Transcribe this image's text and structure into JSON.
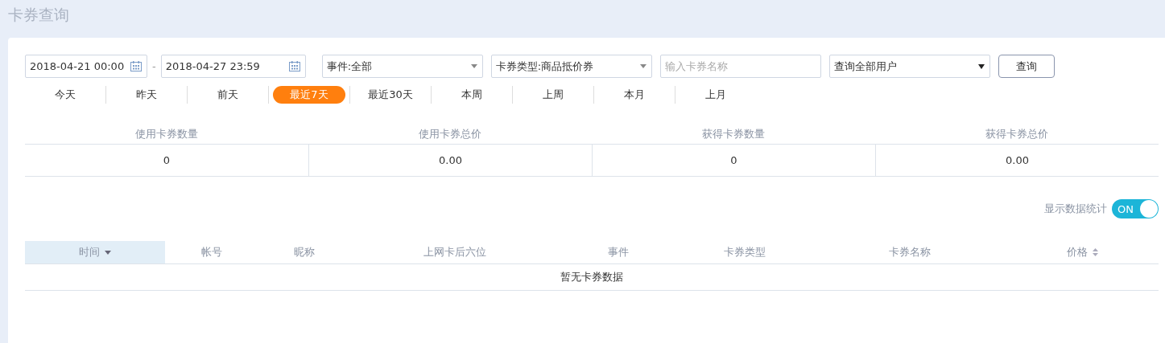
{
  "page_title": "卡券查询",
  "filters": {
    "start_date": "2018-04-21 00:00",
    "separator": "-",
    "end_date": "2018-04-27 23:59",
    "event": "事件:全部",
    "card_type": "卡券类型:商品抵价券",
    "name_field": {
      "placeholder": "输入卡券名称"
    },
    "user_scope": "查询全部用户",
    "query_button": "查询"
  },
  "ranges": [
    {
      "label": "今天",
      "selected": false
    },
    {
      "label": "昨天",
      "selected": false
    },
    {
      "label": "前天",
      "selected": false
    },
    {
      "label": "最近7天",
      "selected": true
    },
    {
      "label": "最近30天",
      "selected": false
    },
    {
      "label": "本周",
      "selected": false
    },
    {
      "label": "上周",
      "selected": false
    },
    {
      "label": "本月",
      "selected": false
    },
    {
      "label": "上月",
      "selected": false
    }
  ],
  "summary": [
    {
      "label": "使用卡券数量",
      "value": "0"
    },
    {
      "label": "使用卡券总价",
      "value": "0.00"
    },
    {
      "label": "获得卡券数量",
      "value": "0"
    },
    {
      "label": "获得卡券总价",
      "value": "0.00"
    }
  ],
  "stats_toggle": {
    "label": "显示数据统计",
    "text": "ON",
    "on": true
  },
  "table": {
    "columns": [
      {
        "label": "时间",
        "selected": true,
        "kind": "descending"
      },
      {
        "label": "帐号",
        "selected": false,
        "kind": "plain"
      },
      {
        "label": "昵称",
        "selected": false,
        "kind": "plain"
      },
      {
        "label": "上网卡后六位",
        "selected": false,
        "kind": "plain"
      },
      {
        "label": "事件",
        "selected": false,
        "kind": "plain"
      },
      {
        "label": "卡券类型",
        "selected": false,
        "kind": "plain"
      },
      {
        "label": "卡券名称",
        "selected": false,
        "kind": "plain"
      },
      {
        "label": "价格",
        "selected": false,
        "kind": "sortable"
      }
    ],
    "empty_message": "暂无卡券数据"
  }
}
